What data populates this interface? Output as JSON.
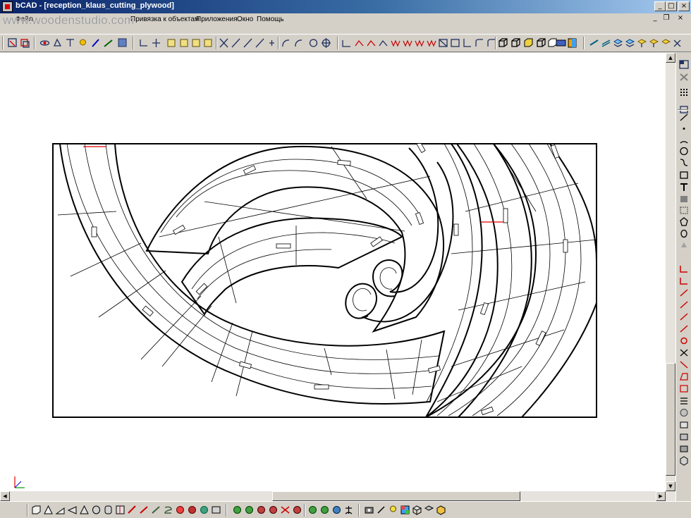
{
  "window": {
    "title": "bCAD - [reception_klaus_cutting_plywood]",
    "controls": {
      "minimize": "_",
      "maximize": "□",
      "close": "×"
    }
  },
  "menubar": {
    "watermark": "www.woodenstudio.com",
    "items": [
      "Файл",
      "Привязка к объектам",
      "Приложения",
      "Окно",
      "Помощь"
    ],
    "mdi_controls": {
      "minimize": "_",
      "restore": "❐",
      "close": "×"
    }
  },
  "toolbars": {
    "top": [
      "zoom-window-icon",
      "regen-icon",
      "orbit-icon",
      "pan-icon",
      "measure-icon",
      "light-icon",
      "pen-icon",
      "edit-icon",
      "render-icon",
      "snap-corner-icon",
      "snap-cross-icon",
      "face-top-icon",
      "face-front-icon",
      "face-side-icon",
      "face-iso-icon",
      "snap-end-icon",
      "snap-mid-icon",
      "snap-perp-icon",
      "snap-tangent-icon",
      "snap-near-icon",
      "arc-snap-icon",
      "arc2-snap-icon",
      "center-snap-icon",
      "quadrant-snap-icon",
      "dim-linear-icon",
      "dim-aligned-icon",
      "dim-angle-icon",
      "dim-arc-icon",
      "dim-baseline-icon",
      "dim-chain-icon",
      "dim-ordinate-icon",
      "dim-radius-icon",
      "dim-diameter-icon",
      "dim-leader-icon",
      "dim-center-icon",
      "dim-style-icon",
      "dim-text-icon",
      "box-icon",
      "box-wire-icon",
      "box-shade-icon",
      "box-hidden-icon",
      "view-plane-icon",
      "color-icon",
      "layer-icon",
      "layer-props-icon",
      "layer-off-icon",
      "layer-on-icon",
      "layer-freeze-icon",
      "layer-lock-icon"
    ],
    "right": [
      "view-icon",
      "ucs-icon",
      "grid-icon",
      "line-icon",
      "point-icon",
      "arc-icon",
      "circle-icon",
      "spline-icon",
      "rectangle-icon",
      "text-icon",
      "hatch-icon",
      "region-icon",
      "polygon-icon",
      "ellipse-icon",
      "fill-icon",
      "trim-icon",
      "extend-icon",
      "offset-icon",
      "mirror-icon",
      "rotate-icon",
      "scale-icon",
      "move-icon",
      "stretch-icon",
      "fillet-icon",
      "chamfer-icon",
      "break-icon",
      "explode-icon",
      "ucs-xyz-icon",
      "plot-icon",
      "print-icon",
      "export-icon",
      "solid-icon"
    ],
    "bottom": [
      "box3d-icon",
      "pyramid-icon",
      "wedge-icon",
      "cone-icon",
      "cylinder-icon",
      "torus-icon",
      "extrude-icon",
      "revolve-icon",
      "loft-icon",
      "sweep-icon",
      "shell-icon",
      "boolean-icon",
      "sphere-icon",
      "union-icon",
      "subtract-icon",
      "intersect-icon",
      "slice-icon",
      "section-icon",
      "anchor-icon",
      "camera-icon",
      "spot-light-icon",
      "bulb-icon",
      "material-icon",
      "texture-icon",
      "render3d-icon"
    ]
  },
  "drawing": {
    "colors": {
      "background": "#ffffff",
      "outline": "#000000",
      "guide": "#000000",
      "marker_red": "#e00000"
    }
  }
}
